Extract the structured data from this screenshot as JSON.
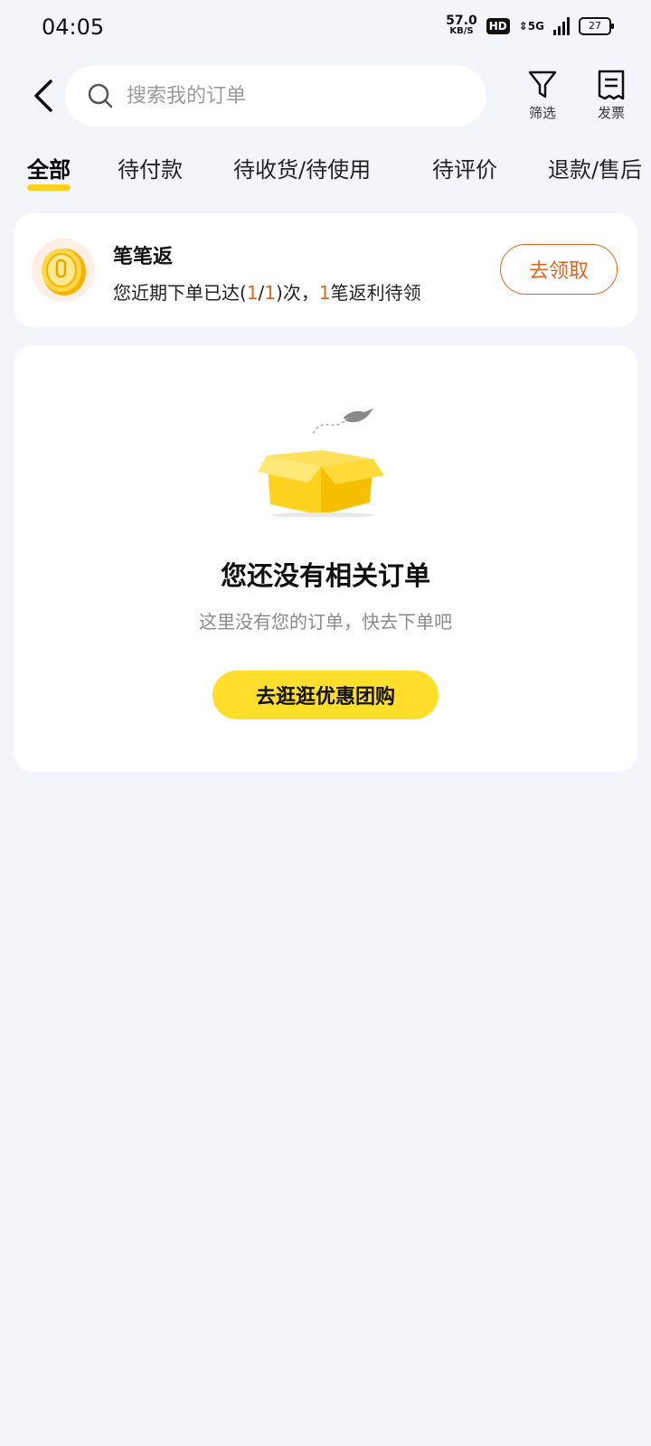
{
  "status_bar": {
    "time": "04:05",
    "net_speed": "57.0",
    "net_unit": "KB/S",
    "hd": "HD",
    "network": "5G",
    "battery": "27"
  },
  "header": {
    "back_icon": "chevron-left-icon",
    "search_placeholder": "搜索我的订单",
    "filter_label": "筛选",
    "invoice_label": "发票"
  },
  "tabs": [
    {
      "label": "全部",
      "active": true
    },
    {
      "label": "待付款",
      "active": false
    },
    {
      "label": "待收货/待使用",
      "active": false
    },
    {
      "label": "待评价",
      "active": false
    },
    {
      "label": "退款/售后",
      "active": false
    }
  ],
  "reward": {
    "title": "笔笔返",
    "desc_prefix": "您近期下单已达(",
    "count_current": "1",
    "slash": "/",
    "count_total": "1",
    "desc_mid": ")次，",
    "pending_count": "1",
    "desc_suffix": "笔返利待领",
    "claim_label": "去领取",
    "accent_color": "#e0661c"
  },
  "empty_state": {
    "title": "您还没有相关订单",
    "subtitle": "这里没有您的订单，快去下单吧",
    "button_label": "去逛逛优惠团购",
    "button_color": "#ffde2c"
  }
}
